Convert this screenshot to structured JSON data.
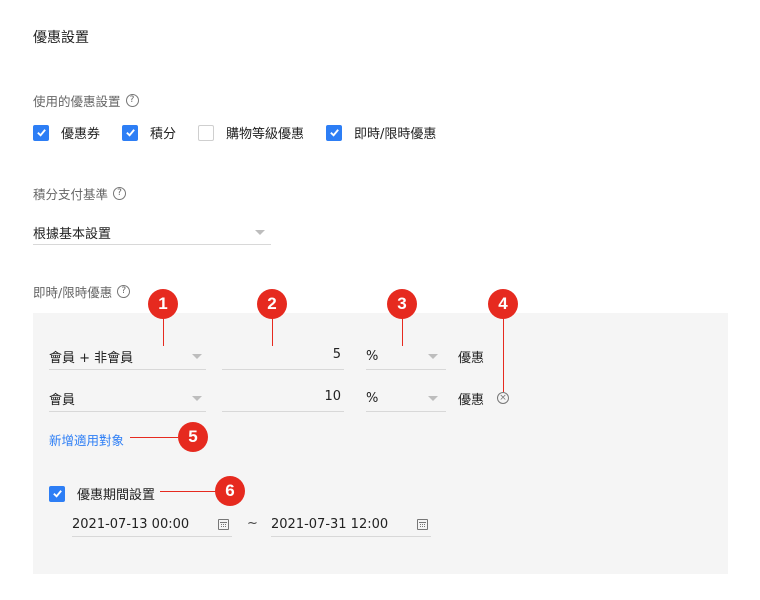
{
  "page": {
    "title": "優惠設置"
  },
  "discount_usage": {
    "label": "使用的優惠設置",
    "options": [
      {
        "label": "優惠券",
        "checked": true
      },
      {
        "label": "積分",
        "checked": true
      },
      {
        "label": "購物等級優惠",
        "checked": false
      },
      {
        "label": "即時/限時優惠",
        "checked": true
      }
    ]
  },
  "points_basis": {
    "label": "積分支付基準",
    "selected": "根據基本設置"
  },
  "instant_discount": {
    "label": "即時/限時優惠",
    "rows": [
      {
        "target": "會員 + 非會員",
        "amount": "5",
        "unit": "%",
        "suffix": "優惠"
      },
      {
        "target": "會員",
        "amount": "10",
        "unit": "%",
        "suffix": "優惠"
      }
    ],
    "add_target_link": "新增適用對象",
    "period": {
      "label": "優惠期間設置",
      "checked": true,
      "start": "2021-07-13 00:00",
      "separator": "~",
      "end": "2021-07-31 12:00"
    }
  },
  "annotations": [
    "1",
    "2",
    "3",
    "4",
    "5",
    "6"
  ],
  "colors": {
    "accent": "#2d7ef5",
    "annotation": "#e62a1f"
  }
}
